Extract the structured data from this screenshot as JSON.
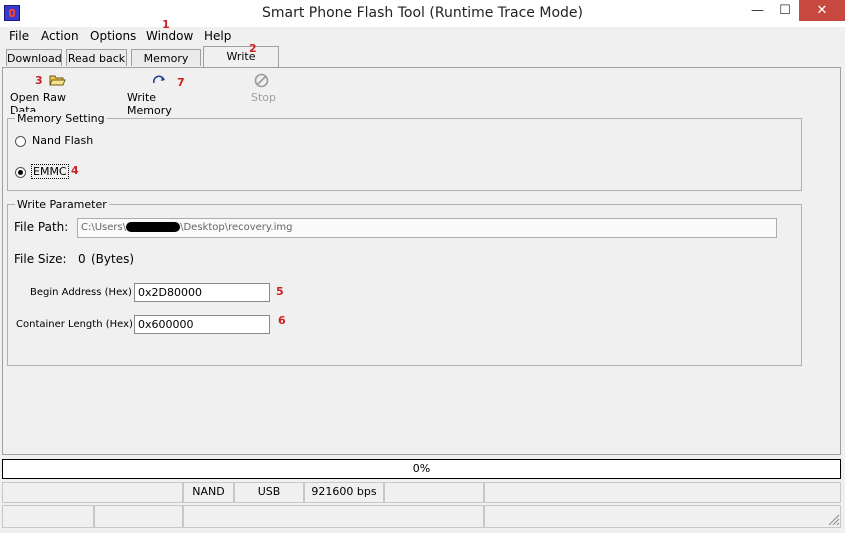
{
  "window": {
    "title": "Smart Phone Flash Tool (Runtime Trace Mode)",
    "min_glyph": "—",
    "max_glyph": "☐",
    "close_glyph": "✕"
  },
  "menu": [
    "File",
    "Action",
    "Options",
    "Window",
    "Help"
  ],
  "tabs": [
    "Download",
    "Read back",
    "Memory Test",
    "Write Memory"
  ],
  "active_tab": "Write Memory",
  "annotations": {
    "n1": "1",
    "n2": "2",
    "n3": "3",
    "n4": "4",
    "n5": "5",
    "n6": "6",
    "n7": "7"
  },
  "toolbar": {
    "open_raw_data": "Open Raw Data",
    "write_memory": "Write Memory",
    "stop": "Stop"
  },
  "memory_setting": {
    "title": "Memory Setting",
    "options": [
      "Nand Flash",
      "EMMC"
    ],
    "selected": "EMMC"
  },
  "write_parameter": {
    "title": "Write Parameter",
    "file_path_label": "File Path:",
    "file_path_prefix": "C:\\Users\\",
    "file_path_suffix": "\\Desktop\\recovery.img",
    "file_size_label": "File Size:",
    "file_size_value": "0",
    "file_size_unit": "(Bytes)",
    "begin_address_label": "Begin Address (Hex) :",
    "begin_address_value": "0x2D80000",
    "container_length_label": "Container Length (Hex) :",
    "container_length_value": "0x600000"
  },
  "progress": {
    "text": "0%",
    "value": 0
  },
  "status": {
    "memory": "NAND",
    "connection": "USB",
    "baud": "921600 bps"
  },
  "icons": [
    "open-folder-icon",
    "write-memory-icon",
    "stop-icon",
    "resize-grip-icon"
  ]
}
